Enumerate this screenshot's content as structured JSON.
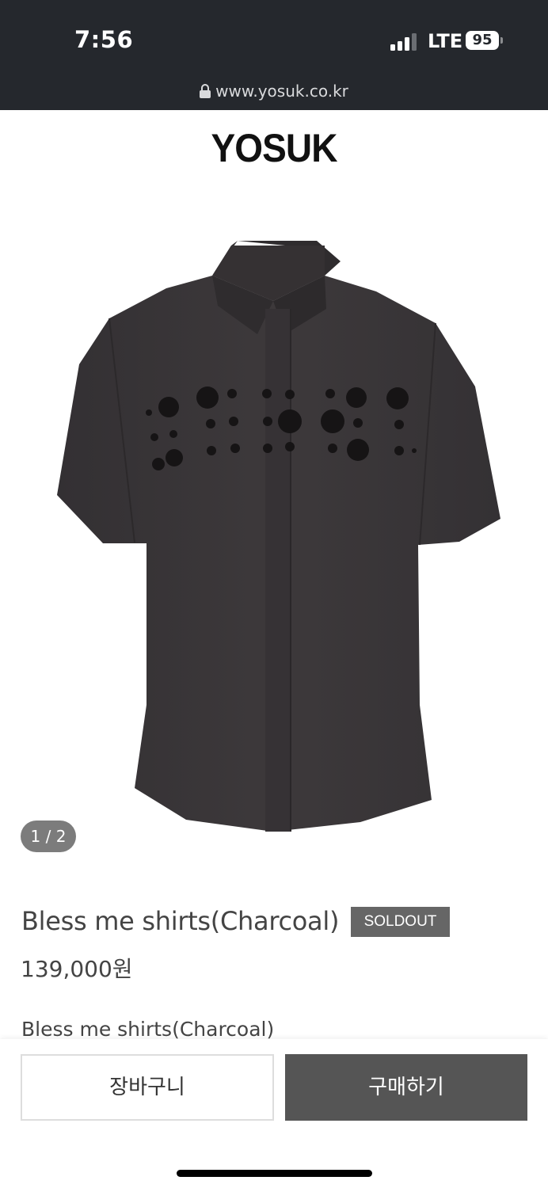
{
  "status_bar": {
    "time": "7:56",
    "network": "LTE",
    "battery": "95"
  },
  "browser": {
    "url": "www.yosuk.co.kr"
  },
  "site": {
    "logo": "YOSUK"
  },
  "gallery": {
    "pager": "1 / 2",
    "image_icon": "charcoal-shirt-image"
  },
  "product": {
    "title": "Bless me shirts(Charcoal)",
    "badge": "SOLDOUT",
    "price": "139,000원",
    "description_title": "Bless me shirts(Charcoal)"
  },
  "actions": {
    "cart_label": "장바구니",
    "buy_label": "구매하기"
  },
  "colors": {
    "topbar": "#25282d",
    "badge": "#666666",
    "buy_button": "#555555",
    "shirt": "#3a3638"
  }
}
